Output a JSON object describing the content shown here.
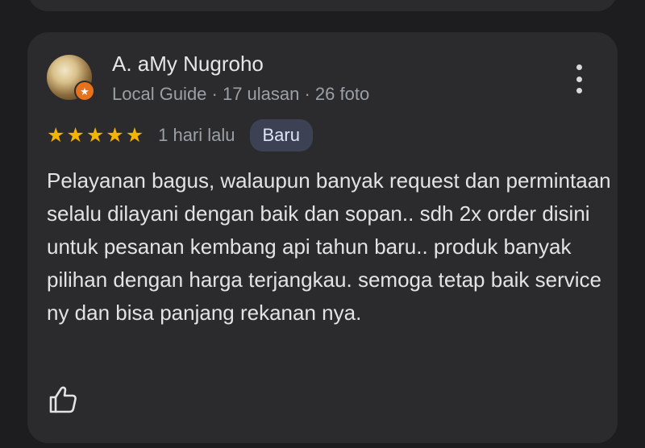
{
  "review": {
    "author": "A. aMy Nugroho",
    "author_meta": "Local Guide · 17 ulasan · 26 foto",
    "rating": 5,
    "time_ago": "1 hari lalu",
    "badge": "Baru",
    "text": "Pelayanan bagus, walaupun banyak request dan permintaan selalu dilayani dengan baik dan sopan.. sdh 2x order disini untuk pesanan kembang api tahun baru.. produk banyak pilihan dengan harga terjangkau. semoga tetap baik service ny dan bisa panjang rekanan nya."
  },
  "icons": {
    "avatar_badge": "local-guide-star-icon",
    "more": "more-vert-icon",
    "star": "star-icon",
    "like": "thumbs-up-icon"
  },
  "colors": {
    "background": "#1d1d1f",
    "card": "#2b2b2d",
    "star": "#f6b400",
    "badge_bg": "#3c4254",
    "local_guide": "#e8711c"
  }
}
